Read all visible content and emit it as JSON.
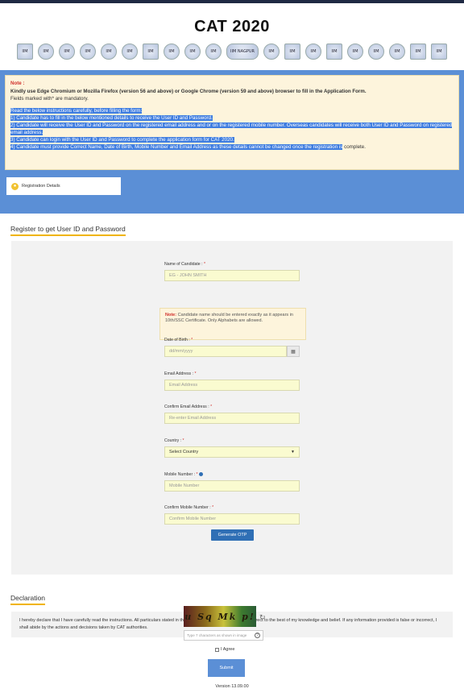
{
  "header": {
    "title": "CAT 2020",
    "logos": [
      "IIM",
      "IIM",
      "IIM",
      "IIM",
      "IIM",
      "IIM",
      "IIM",
      "IIM",
      "IIM",
      "IIM",
      "IIM NAGPUR",
      "IIM",
      "IIM",
      "IIM",
      "IIM",
      "IIM",
      "IIM",
      "IIM",
      "IIM",
      "IIM"
    ]
  },
  "notice": {
    "label": "Note :",
    "browser": "Kindly use Edge Chromium or Mozilla Firefox (version 56 and above) or Google Chrome (version 59 and above) browser to fill in the Application Form.",
    "mandatory": "Fields marked with* are mandatory.",
    "intro": "Read the below instructions carefully, before filling the form:",
    "points": [
      "1) Candidate has to fill in the below mentioned details to receive the User ID and Password.",
      "2) Candidate will receive the User ID and Password on the registered email address and or on the registered mobile number. Overseas candidates will receive both User ID and Password on registered email address.",
      "3) Candidate can login with the User ID and Password to complete the application form for CAT 2020.",
      "4) Candidate must provide Correct Name, Date of Birth, Mobile Number and Email Address as these details cannot be changed once the registration is"
    ],
    "point4_tail": " complete."
  },
  "tab": {
    "label": "Registration Details"
  },
  "form": {
    "heading": "Register to get User ID and Password",
    "name_label": "Name of Candidate :",
    "name_placeholder": "EG - JOHN SMITH",
    "name_note_label": "Note:",
    "name_note": "Candidate name should be entered exactly as it appears in 10th/SSC Certificate. Only Alphabets are allowed.",
    "dob_label": "Date of Birth :",
    "dob_placeholder": "dd/mm/yyyy",
    "email_label": "Email Address :",
    "email_placeholder": "Email Address",
    "confirm_email_label": "Confirm Email Address :",
    "confirm_email_placeholder": "Re-enter Email Address",
    "country_label": "Country :",
    "country_value": "Select Country",
    "mobile_label": "Mobile Number :",
    "mobile_placeholder": "Mobile Number",
    "confirm_mobile_label": "Confirm Mobile Number :",
    "confirm_mobile_placeholder": "Confirm Mobile Number",
    "otp_button": "Generate OTP",
    "required_mark": "*"
  },
  "declaration": {
    "heading": "Declaration",
    "text": "I hereby declare that I have carefully read the instructions. All particulars stated in this Registration Form are true and correct to the best of my knowledge and belief. If any information provided is false or incorrect, I shall abide by the actions and decisions taken by CAT authorities."
  },
  "captcha": {
    "text": "u Sq Mk p!",
    "placeholder": "Type 7 characters as shown in image",
    "help": "?"
  },
  "agree_label": "I Agree",
  "submit_label": "Submit",
  "version": "Version 13.09.00"
}
